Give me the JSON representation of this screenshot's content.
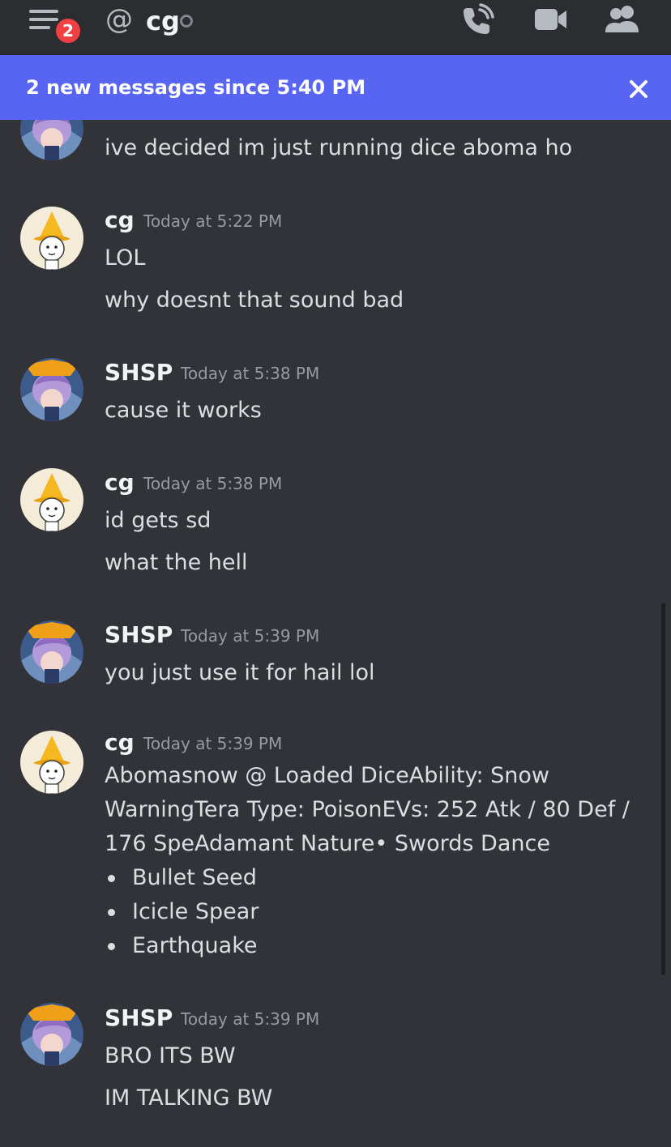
{
  "header": {
    "unread_badge": "2",
    "channel_name": "cg",
    "icons": [
      "menu-icon",
      "at-icon",
      "status-offline-icon",
      "call-icon",
      "video-icon",
      "member-list-icon"
    ]
  },
  "banner": {
    "text": "2 new messages since 5:40 PM",
    "close_icon": "close-icon"
  },
  "messages": [
    {
      "author": "SHSP",
      "timestamp": "",
      "lines": [
        "ive decided im just running dice aboma ho"
      ]
    },
    {
      "author": "cg",
      "timestamp": "Today at 5:22 PM",
      "lines": [
        "LOL",
        "why doesnt that sound bad"
      ]
    },
    {
      "author": "SHSP",
      "timestamp": "Today at 5:38 PM",
      "lines": [
        "cause it works"
      ]
    },
    {
      "author": "cg",
      "timestamp": "Today at 5:38 PM",
      "lines": [
        "id gets sd",
        "what the hell"
      ]
    },
    {
      "author": "SHSP",
      "timestamp": "Today at 5:39 PM",
      "lines": [
        "you just use it for hail lol"
      ]
    },
    {
      "author": "cg",
      "timestamp": "Today at 5:39 PM",
      "lines": [
        "Abomasnow @ Loaded DiceAbility: Snow",
        "WarningTera Type: PoisonEVs: 252 Atk / 80 Def /",
        "176 SpeAdamant Nature•  Swords Dance"
      ],
      "bullets": [
        "Bullet Seed",
        "Icicle Spear",
        "Earthquake"
      ]
    },
    {
      "author": "SHSP",
      "timestamp": "Today at 5:39 PM",
      "lines": [
        "BRO ITS BW",
        "IM TALKING BW"
      ]
    }
  ],
  "colors": {
    "background": "#313338",
    "header": "#2b2d31",
    "banner": "#5865f2",
    "badge": "#f23f43"
  }
}
